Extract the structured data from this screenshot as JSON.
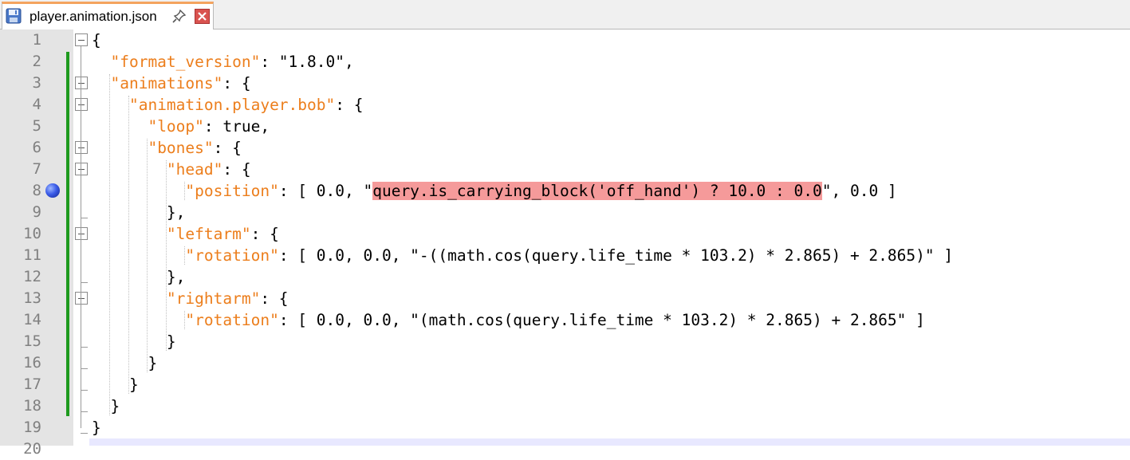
{
  "tab": {
    "file_name": "player.animation.json",
    "save_icon": "save-icon",
    "pin_icon": "pin-icon",
    "close_icon": "close-icon"
  },
  "colors": {
    "key": "#ec7e1c",
    "highlight": "#f59a9a",
    "change_bar": "#1e9a1e",
    "tab_accent": "#f4a35e",
    "gutter": "#e4e4e4"
  },
  "bookmark_line": 8,
  "lines": [
    {
      "n": "1",
      "segs": [
        {
          "t": "{"
        }
      ]
    },
    {
      "n": "2",
      "segs": [
        {
          "t": "  "
        },
        {
          "t": "\"format_version\"",
          "c": "k"
        },
        {
          "t": ": \"1.8.0\","
        }
      ]
    },
    {
      "n": "3",
      "segs": [
        {
          "t": "  "
        },
        {
          "t": "\"animations\"",
          "c": "k"
        },
        {
          "t": ": {"
        }
      ]
    },
    {
      "n": "4",
      "segs": [
        {
          "t": "    "
        },
        {
          "t": "\"animation.player.bob\"",
          "c": "k"
        },
        {
          "t": ": {"
        }
      ]
    },
    {
      "n": "5",
      "segs": [
        {
          "t": "      "
        },
        {
          "t": "\"loop\"",
          "c": "k"
        },
        {
          "t": ": true,"
        }
      ]
    },
    {
      "n": "6",
      "segs": [
        {
          "t": "      "
        },
        {
          "t": "\"bones\"",
          "c": "k"
        },
        {
          "t": ": {"
        }
      ]
    },
    {
      "n": "7",
      "segs": [
        {
          "t": "        "
        },
        {
          "t": "\"head\"",
          "c": "k"
        },
        {
          "t": ": {"
        }
      ]
    },
    {
      "n": "8",
      "segs": [
        {
          "t": "          "
        },
        {
          "t": "\"position\"",
          "c": "k"
        },
        {
          "t": ": [ 0.0, \""
        },
        {
          "t": "query.is_carrying_block('off_hand') ? 10.0 : 0.0",
          "c": "hl"
        },
        {
          "t": "\", 0.0 ]"
        }
      ]
    },
    {
      "n": "9",
      "segs": [
        {
          "t": "        },"
        }
      ]
    },
    {
      "n": "10",
      "segs": [
        {
          "t": "        "
        },
        {
          "t": "\"leftarm\"",
          "c": "k"
        },
        {
          "t": ": {"
        }
      ]
    },
    {
      "n": "11",
      "segs": [
        {
          "t": "          "
        },
        {
          "t": "\"rotation\"",
          "c": "k"
        },
        {
          "t": ": [ 0.0, 0.0, \"-((math.cos(query.life_time * 103.2) * 2.865) + 2.865)\" ]"
        }
      ]
    },
    {
      "n": "12",
      "segs": [
        {
          "t": "        },"
        }
      ]
    },
    {
      "n": "13",
      "segs": [
        {
          "t": "        "
        },
        {
          "t": "\"rightarm\"",
          "c": "k"
        },
        {
          "t": ": {"
        }
      ]
    },
    {
      "n": "14",
      "segs": [
        {
          "t": "          "
        },
        {
          "t": "\"rotation\"",
          "c": "k"
        },
        {
          "t": ": [ 0.0, 0.0, \"(math.cos(query.life_time * 103.2) * 2.865) + 2.865\" ]"
        }
      ]
    },
    {
      "n": "15",
      "segs": [
        {
          "t": "        }"
        }
      ]
    },
    {
      "n": "16",
      "segs": [
        {
          "t": "      }"
        }
      ]
    },
    {
      "n": "17",
      "segs": [
        {
          "t": "    }"
        }
      ]
    },
    {
      "n": "18",
      "segs": [
        {
          "t": "  }"
        }
      ]
    },
    {
      "n": "19",
      "segs": [
        {
          "t": "}"
        }
      ]
    },
    {
      "n": "20",
      "segs": []
    }
  ]
}
